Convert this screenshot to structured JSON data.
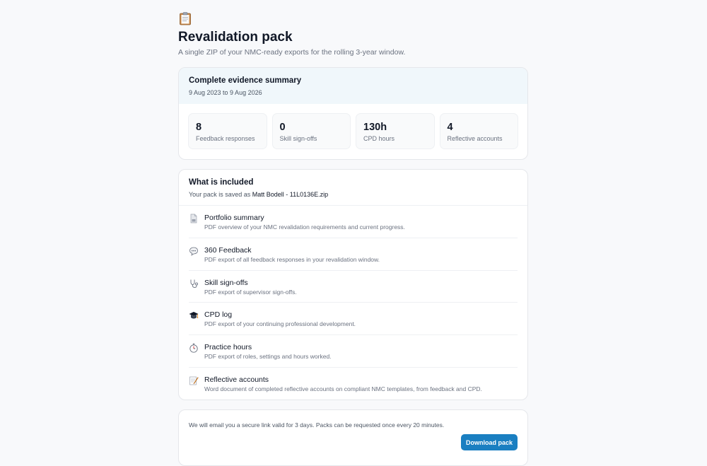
{
  "header": {
    "icon": "clipboard-icon",
    "title": "Revalidation pack",
    "subtitle": "A single ZIP of your NMC-ready exports for the rolling 3-year window."
  },
  "summary": {
    "title": "Complete evidence summary",
    "date_range": "9 Aug 2023 to 9 Aug 2026",
    "stats": [
      {
        "value": "8",
        "label": "Feedback responses"
      },
      {
        "value": "0",
        "label": "Skill sign-offs"
      },
      {
        "value": "130h",
        "label": "CPD hours"
      },
      {
        "value": "4",
        "label": "Reflective accounts"
      }
    ]
  },
  "included": {
    "title": "What is included",
    "saved_prefix": "Your pack is saved as",
    "filename": "Matt Bodell - 11L0136E.zip",
    "items": [
      {
        "icon": "document-icon",
        "title": "Portfolio summary",
        "desc": "PDF overview of your NMC revalidation requirements and current progress."
      },
      {
        "icon": "speech-bubble-icon",
        "title": "360 Feedback",
        "desc": "PDF export of all feedback responses in your revalidation window."
      },
      {
        "icon": "stethoscope-icon",
        "title": "Skill sign-offs",
        "desc": "PDF export of supervisor sign-offs."
      },
      {
        "icon": "graduation-cap-icon",
        "title": "CPD log",
        "desc": "PDF export of your continuing professional development."
      },
      {
        "icon": "stopwatch-icon",
        "title": "Practice hours",
        "desc": "PDF export of roles, settings and hours worked."
      },
      {
        "icon": "memo-icon",
        "title": "Reflective accounts",
        "desc": "Word document of completed reflective accounts on compliant NMC templates, from feedback and CPD."
      }
    ]
  },
  "download": {
    "notice": "We will email you a secure link valid for 3 days. Packs can be requested once every 20 minutes.",
    "button_label": "Download pack"
  },
  "colors": {
    "accent": "#1a7fc1",
    "summary_header_bg": "#f0f7fb",
    "page_bg": "#f8f9fb"
  }
}
